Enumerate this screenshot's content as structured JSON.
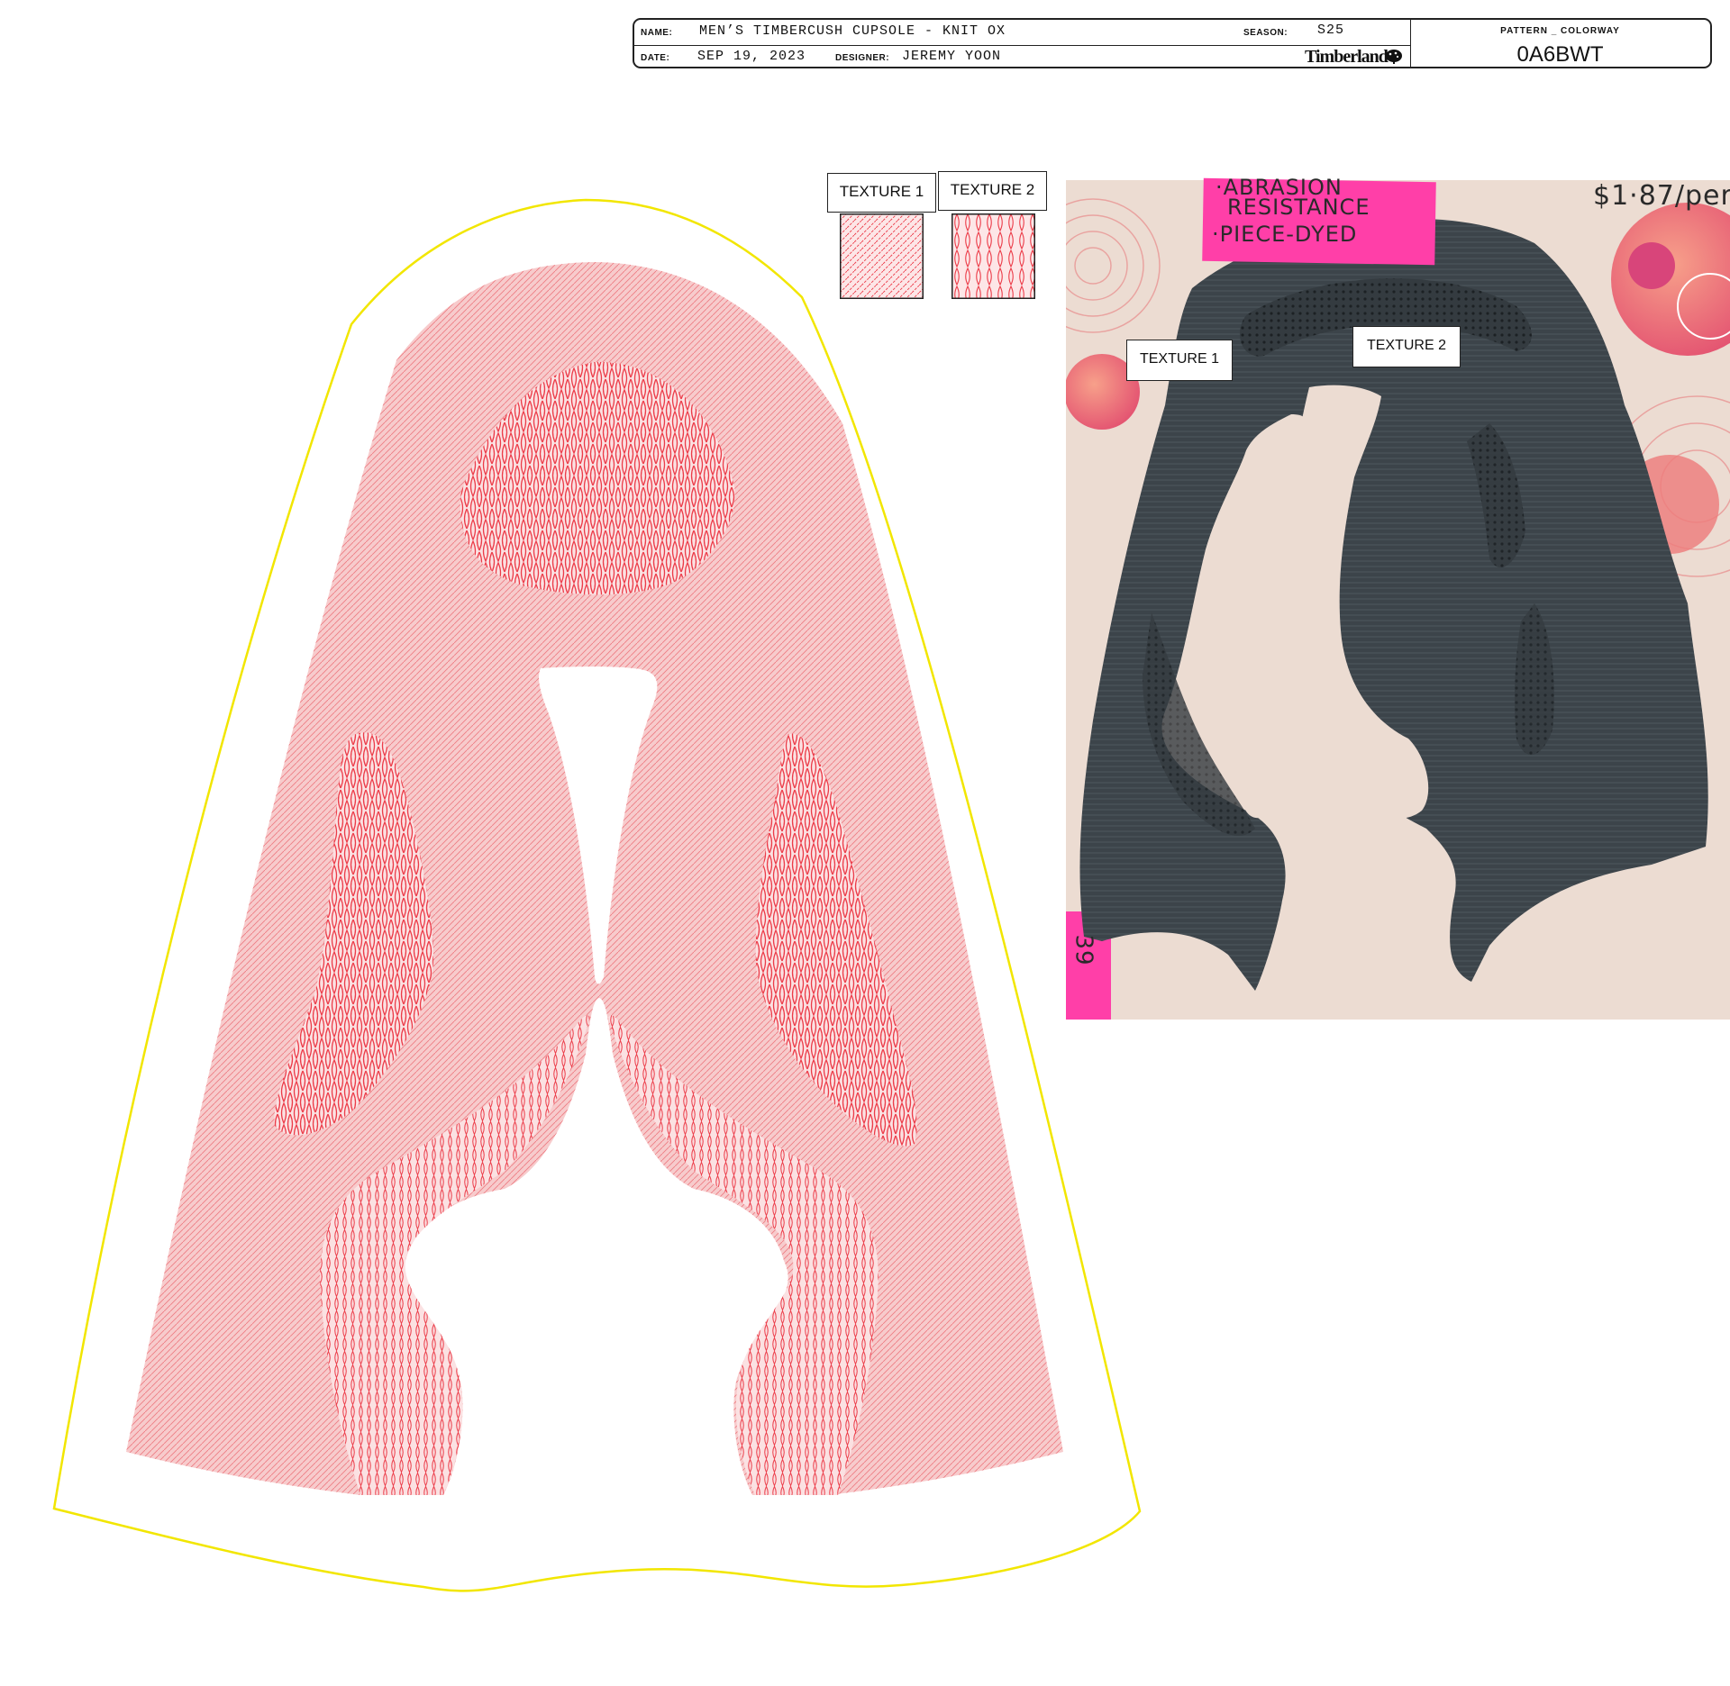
{
  "title_block": {
    "name_label": "NAME:",
    "name_value": "MEN’S TIMBERCUSH CUPSOLE - KNIT OX",
    "season_label": "SEASON:",
    "season_value": "S25",
    "date_label": "DATE:",
    "date_value": "SEP 19, 2023",
    "designer_label": "DESIGNER:",
    "designer_value": "JEREMY YOON",
    "brand": "Timberland",
    "brand_icon": "tree-logo-icon",
    "pattern_colorway_label": "PATTERN _ COLORWAY",
    "pattern_colorway_value": "0A6BWT"
  },
  "legend": {
    "texture1": "TEXTURE 1",
    "texture2": "TEXTURE 2"
  },
  "photo": {
    "texture1_label": "TEXTURE 1",
    "texture2_label": "TEXTURE 2",
    "note_line1": "·ABRASION",
    "note_line2": "RESISTANCE",
    "note_line3": "·PIECE-DYED",
    "price": "$1·87/per",
    "tag_text": "39"
  },
  "colors": {
    "pattern_pink": "#f6c4c6",
    "texture_red": "#ec3b48",
    "outline_yellow": "#f2e600",
    "knit_dark": "#3c444a",
    "wall": "#ecdcd2",
    "sticky_pink": "#ff3fa8"
  }
}
